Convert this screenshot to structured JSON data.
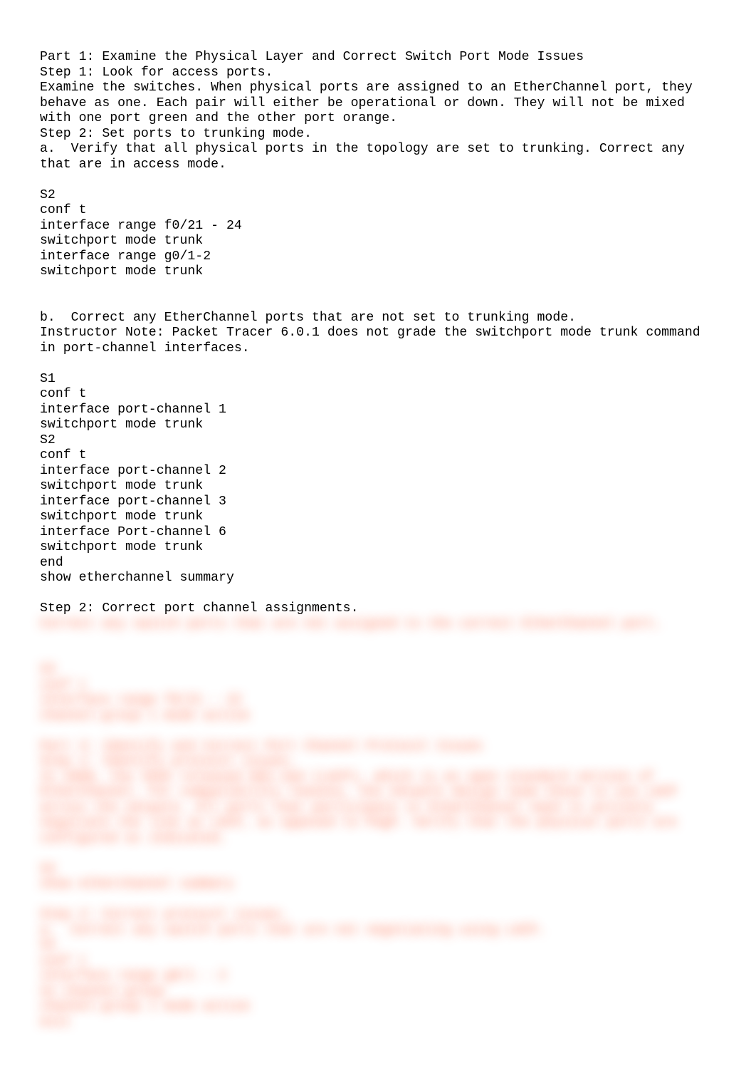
{
  "doc": {
    "visible": "Part 1: Examine the Physical Layer and Correct Switch Port Mode Issues\nStep 1: Look for access ports.\nExamine the switches. When physical ports are assigned to an EtherChannel port, they behave as one. Each pair will either be operational or down. They will not be mixed with one port green and the other port orange.\nStep 2: Set ports to trunking mode.\na.  Verify that all physical ports in the topology are set to trunking. Correct any that are in access mode.\n\nS2\nconf t\ninterface range f0/21 - 24\nswitchport mode trunk\ninterface range g0/1-2\nswitchport mode trunk\n\n\nb.  Correct any EtherChannel ports that are not set to trunking mode.\nInstructor Note: Packet Tracer 6.0.1 does not grade the switchport mode trunk command in port-channel interfaces.\n\nS1\nconf t\ninterface port-channel 1\nswitchport mode trunk\nS2\nconf t\ninterface port-channel 2\nswitchport mode trunk\ninterface port-channel 3\nswitchport mode trunk\ninterface Port-channel 6\nswitchport mode trunk\nend\nshow etherchannel summary\n\nStep 2: Correct port channel assignments.",
    "hidden": "Correct any switch ports that are not assigned to the correct EtherChannel port.\n\n\nS3\nconf t\ninterface range f0/21 - 22\nchannel-group 1 mode active\n\nPart 3: Identify and Correct Port Channel Protocol Issues\nStep 1: Identify protocol issues.\nIn 2000, the IEEE released 802.3ad (LACP), which is an open standard version of EtherChannel. For compatibility reasons, the network design team chose to use LACP across the network. All ports that participate in EtherChannel need to actively negotiate the link as LACP, as opposed to PAgP. Verify that the physical ports are configured as indicated.\n\nS4\nshow etherchannel summary\n\nStep 2: Correct protocol issues.\na.  Correct any switch ports that are not negotiating using LACP.\nS4\nconf t\ninterface range g0/1 - 2\nno channel-group\nchannel-group 1 mode active\nexit"
  }
}
